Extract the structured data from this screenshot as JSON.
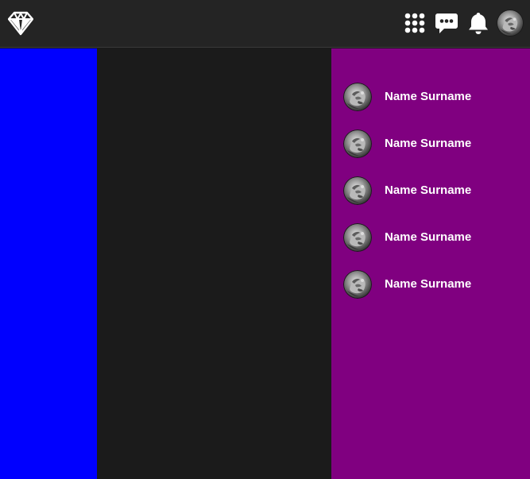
{
  "colors": {
    "topbar_bg": "#242424",
    "left_panel": "#0000ff",
    "center_panel": "#1b1b1b",
    "right_panel": "#800080",
    "icon": "#ffffff"
  },
  "header": {
    "logo_icon": "diamond-icon",
    "actions": [
      {
        "icon": "apps-grid-icon"
      },
      {
        "icon": "chat-bubble-icon"
      },
      {
        "icon": "bell-icon"
      },
      {
        "icon": "avatar"
      }
    ]
  },
  "contacts": [
    {
      "name": "Name Surname"
    },
    {
      "name": "Name Surname"
    },
    {
      "name": "Name Surname"
    },
    {
      "name": "Name Surname"
    },
    {
      "name": "Name Surname"
    }
  ]
}
